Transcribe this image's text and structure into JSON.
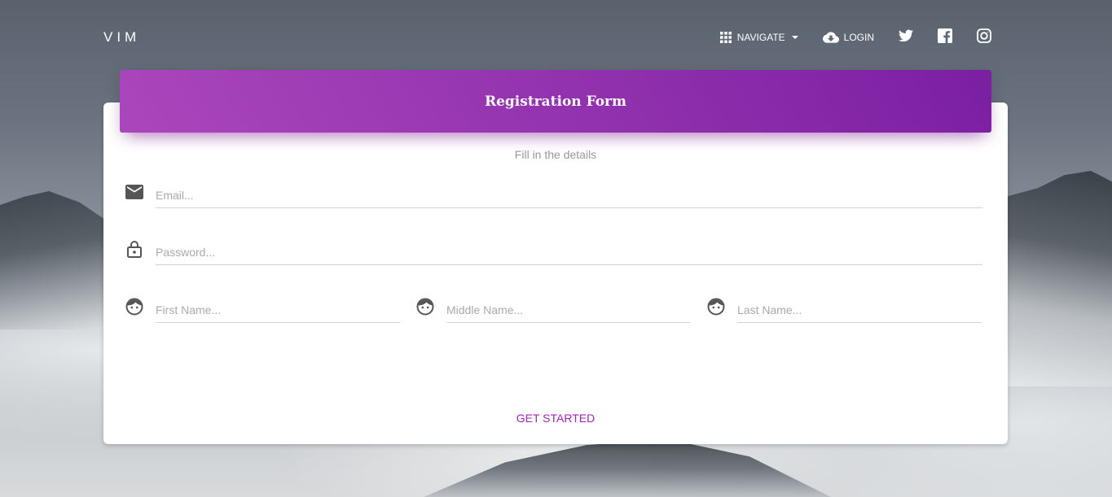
{
  "navbar": {
    "brand": "VIM",
    "navigate_label": "NAVIGATE",
    "login_label": "LOGIN",
    "social_icons": [
      "twitter-icon",
      "facebook-icon",
      "instagram-icon"
    ]
  },
  "form": {
    "title": "Registration Form",
    "subtitle": "Fill in the details",
    "email_placeholder": "Email...",
    "password_placeholder": "Password...",
    "first_name_placeholder": "First Name...",
    "middle_name_placeholder": "Middle Name...",
    "last_name_placeholder": "Last Name...",
    "submit_label": "GET STARTED"
  },
  "colors": {
    "accent": "#9c27b0",
    "header_gradient_start": "#ab47bc",
    "header_gradient_end": "#7b1fa2"
  }
}
